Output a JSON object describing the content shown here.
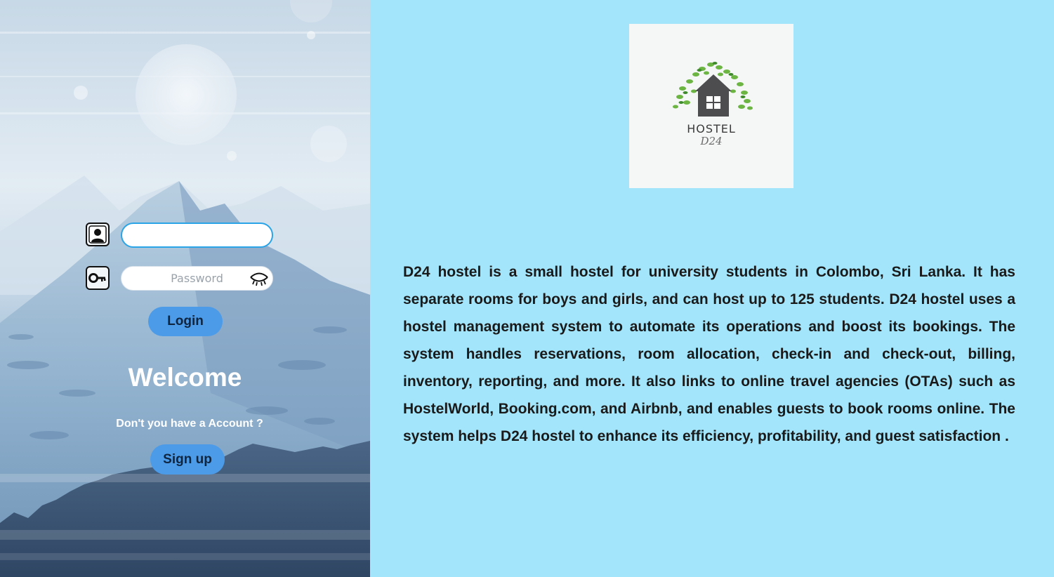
{
  "login": {
    "username_value": "",
    "password_placeholder": "Password",
    "login_label": "Login",
    "welcome_text": "Welcome",
    "no_account_text": "Don't you have a Account ?",
    "signup_label": "Sign up"
  },
  "icons": {
    "user": "user-icon",
    "key": "key-icon",
    "eye": "eye-closed-icon"
  },
  "logo": {
    "title": "HOSTEL",
    "subtitle": "D24"
  },
  "about": {
    "description": "D24 hostel is a small hostel for university students in Colombo, Sri Lanka. It has separate rooms for boys and girls, and can host up to 125 students. D24 hostel uses a hostel management system to automate its operations and boost its bookings. The system handles reservations, room allocation, check-in and check-out, billing, inventory, reporting, and more. It also links to online travel agencies (OTAs) such as HostelWorld, Booking.com, and Airbnb, and enables guests to book rooms online. The system helps D24 hostel to enhance its efficiency, profitability, and guest satisfaction ."
  },
  "colors": {
    "right_bg": "#a3e6fb",
    "button_bg": "#4c9be8",
    "input_focus_border": "#2aa4e6"
  }
}
